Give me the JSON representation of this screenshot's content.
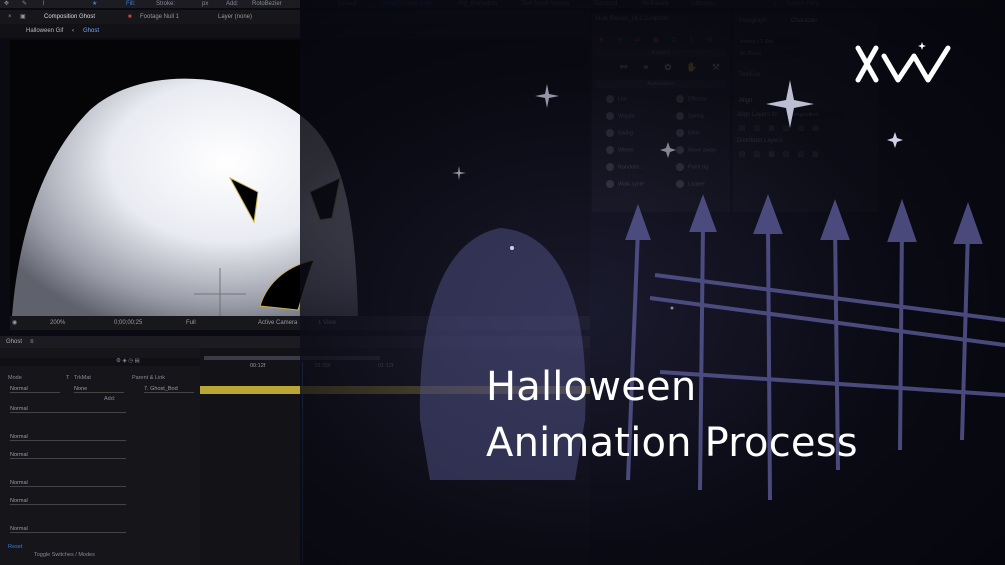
{
  "toolbar": {
    "fill_label": "Fill:",
    "stroke_label": "Stroke:",
    "px_label": "px",
    "add_label": "Add:",
    "rotobezier_label": "RotoBezier",
    "workspace_default": "Default",
    "workspace_small_screen": "Small Screen Duik",
    "workspace_rig": "Rig_Animation",
    "workspace_text": "Text Small Screen",
    "workspace_standard": "Standard",
    "workspace_all_panels": "All Panels",
    "workspace_libraries": "Libraries",
    "search_placeholder": "Search Help"
  },
  "composition": {
    "panel_title": "Composition Ghost",
    "footage_label": "Footage Null 1",
    "layer_label": "Layer (none)",
    "breadcrumb_parent": "Halloween Gif",
    "breadcrumb_current": "Ghost",
    "zoom": "200%",
    "timecode": "0;00;00;25",
    "resolution": "Full",
    "camera": "Active Camera",
    "view": "1 View"
  },
  "duik": {
    "title": "Duik Bassel_16.1.0-Alpha4",
    "rigging_label": "Rigging",
    "automation_label": "Automation",
    "items": [
      {
        "label": "List"
      },
      {
        "label": "Effector"
      },
      {
        "label": "Wiggle"
      },
      {
        "label": "Spring"
      },
      {
        "label": "Swing"
      },
      {
        "label": "Blink"
      },
      {
        "label": "Wheel"
      },
      {
        "label": "Move away"
      },
      {
        "label": "Random..."
      },
      {
        "label": "Paint rig"
      },
      {
        "label": "Walk cycle"
      },
      {
        "label": "Looper"
      }
    ]
  },
  "character": {
    "tab_paragraph": "Paragraph",
    "tab_character": "Character",
    "font_family": "Avenir LT Std",
    "font_style": "95 Black",
    "textexe_label": "TextEve",
    "align_label": "Align",
    "align_layers_to": "Align Layers to:",
    "align_target": "Composition",
    "distribute_label": "Distribute Layers:"
  },
  "timeline": {
    "tab_label": "Ghost",
    "col_mode": "Mode",
    "col_t": "T",
    "col_trkmat": "TrkMat",
    "col_parent": "Parent & Link",
    "row_mode": "Normal",
    "row_trkmat": "None",
    "row_parent": "7. Ghost_Bod",
    "add_label": "Add:",
    "sub_modes": [
      "Normal",
      "Normal",
      "Normal",
      "Normal",
      "Normal",
      "Normal"
    ],
    "reset_label": "Reset",
    "toggle_label": "Toggle Switches / Modes",
    "ruler_marks": [
      "00:12f",
      "01:00f",
      "01:12f"
    ]
  },
  "overlay": {
    "title_line1": "Halloween",
    "title_line2": "Animation Process"
  },
  "colors": {
    "accent_blue": "#3b7dd8",
    "keyframe_yellow": "#d4c23a",
    "title_white": "#ffffff",
    "fence_purple": "#55558f"
  }
}
